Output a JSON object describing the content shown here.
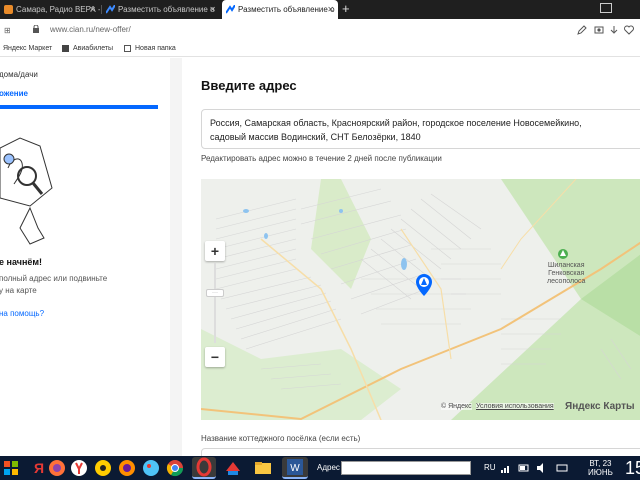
{
  "browser": {
    "tabs": [
      {
        "title": "Самара, Радио ВЕРА -",
        "active": false
      },
      {
        "title": "Разместить объявление о",
        "active": false
      },
      {
        "title": "Разместить объявление о",
        "active": true
      }
    ],
    "new_tab_symbol": "+",
    "url": "www.cian.ru/new-offer/",
    "bookmarks": [
      "Яндекс Маркет",
      "Авиабилеты",
      "Новая папка"
    ]
  },
  "sidebar": {
    "item_category": "дома/дачи",
    "item_location": "ожение",
    "progress_fraction": 1.0,
    "start_title": "е начнём!",
    "start_desc_line1": "полный адрес или подвиньте",
    "start_desc_line2": "у на карте",
    "help_link": "на помощь?"
  },
  "main": {
    "heading": "Введите адрес",
    "address_value_line1": "Россия, Самарская область, Красноярский район, городское поселение Новосемейкино,",
    "address_value_line2": "садовый массив Водинский, СНТ Белозёрки, 1840",
    "address_hint": "Редактировать адрес можно в течение 2 дней после публикации",
    "map": {
      "zoom_in": "+",
      "zoom_out": "−",
      "zoom_scale_label": "···",
      "poi_label_1": "Шиланская",
      "poi_label_2": "Генковская",
      "poi_label_3": "лесополоса",
      "copyright": "© Яндекс",
      "terms_link": "Условия использования",
      "brand": "Яндекс Карты"
    },
    "next_field_label": "Название коттеджного посёлка (если есть)"
  },
  "taskbar": {
    "address_label": "Адрес",
    "lang": "RU",
    "day": "ВТ, 23",
    "month": "ИЮНЬ",
    "big_number": "15"
  },
  "colors": {
    "accent_blue": "#0468ff",
    "map_green": "#b9dfa6",
    "road_orange": "#f2c37a",
    "taskbar": "#0b1a33"
  }
}
